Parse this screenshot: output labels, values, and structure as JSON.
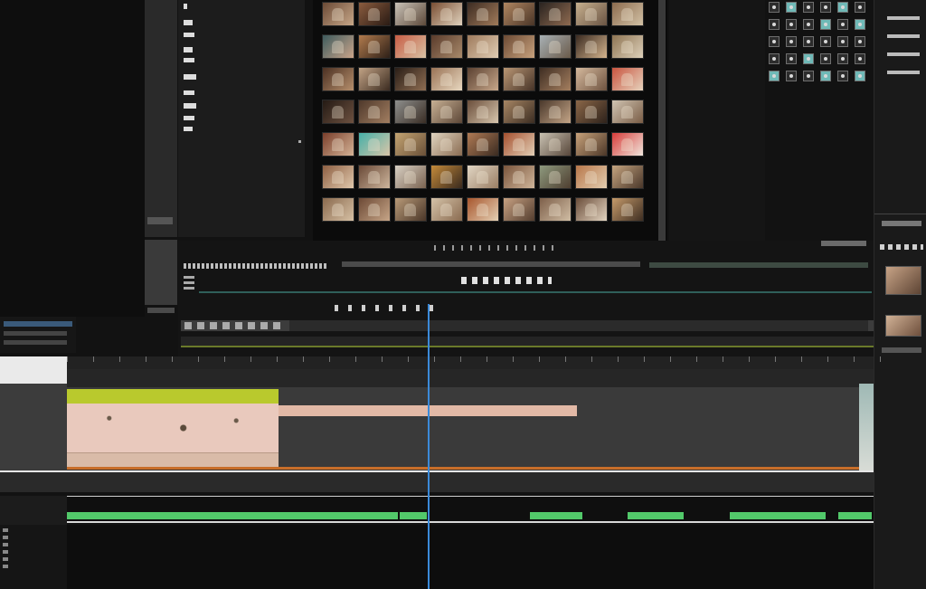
{
  "colors": {
    "background": "#121212",
    "panel": "#1b1b1b",
    "playhead": "#3b8ad9",
    "video_clip_bar": "#b9c92d",
    "video_clip_body": "#e8c5b8",
    "audio_clip": "#52c96a",
    "track_underline": "#c86e2a"
  },
  "icons": {
    "browser_view": "grid-icon",
    "effects": "effects-icon",
    "playhead": "playhead-icon"
  },
  "media_browser": {
    "thumbnails": [
      [
        "#6b4a36",
        "#c7a788"
      ],
      [
        "#8a5b3e",
        "#2a1b14"
      ],
      [
        "#c9c2b8",
        "#5d4a3a"
      ],
      [
        "#7a4e33",
        "#e0d2bd"
      ],
      [
        "#3d2c22",
        "#a07a5a"
      ],
      [
        "#b08661",
        "#4a3527"
      ],
      [
        "#2b2420",
        "#8e6a50"
      ],
      [
        "#c7b08e",
        "#6a5443"
      ],
      [
        "#8c6b4e",
        "#d2c1a5"
      ],
      [
        "#3e5b5d",
        "#caa48a"
      ],
      [
        "#b27b4d",
        "#2e2018"
      ],
      [
        "#c85d45",
        "#d8c2a4"
      ],
      [
        "#5a3b2b",
        "#a88a6b"
      ],
      [
        "#9e7a5c",
        "#e0cdb4"
      ],
      [
        "#6c4a34",
        "#c8a27d"
      ],
      [
        "#a8b1b5",
        "#6a5a4a"
      ],
      [
        "#3a2a20",
        "#d4b48e"
      ],
      [
        "#8e7452",
        "#ddd0ba"
      ],
      [
        "#4b3022",
        "#b68f6c"
      ],
      [
        "#c2a385",
        "#3b2b20"
      ],
      [
        "#2a1e17",
        "#8e6d52"
      ],
      [
        "#9a7356",
        "#e8d8c0"
      ],
      [
        "#5b4131",
        "#c7a78a"
      ],
      [
        "#b99674",
        "#463327"
      ],
      [
        "#3f2e23",
        "#a57f5f"
      ],
      [
        "#d5b99d",
        "#6e5340"
      ],
      [
        "#c9543f",
        "#e6d3bd"
      ],
      [
        "#241a14",
        "#6d5140"
      ],
      [
        "#4f392b",
        "#a27e61"
      ],
      [
        "#8e8f8d",
        "#3a2e25"
      ],
      [
        "#c7b094",
        "#5d4737"
      ],
      [
        "#6a4e3a",
        "#d8c6ae"
      ],
      [
        "#a78664",
        "#3c2d22"
      ],
      [
        "#4a382b",
        "#c4a587"
      ],
      [
        "#8b6748",
        "#2e221b"
      ],
      [
        "#d0c4b2",
        "#7a5d46"
      ],
      [
        "#7a3e2b",
        "#d4b396"
      ],
      [
        "#46b0a8",
        "#d9c5a8"
      ],
      [
        "#c4a472",
        "#6a5038"
      ],
      [
        "#e0d4c0",
        "#8a6c52"
      ],
      [
        "#b07a54",
        "#3a2b21"
      ],
      [
        "#a5502f",
        "#e2cfb6"
      ],
      [
        "#c9c2b2",
        "#57463a"
      ],
      [
        "#c8a27a",
        "#4c3728"
      ],
      [
        "#d73c3a",
        "#f0e6dc"
      ],
      [
        "#8d5f42",
        "#e0c8ac"
      ],
      [
        "#6a4a38",
        "#cdb59c"
      ],
      [
        "#d8d0c4",
        "#7a6350"
      ],
      [
        "#c48a3a",
        "#3a2a1e"
      ],
      [
        "#e1d6c4",
        "#9a7e64"
      ],
      [
        "#7a553c",
        "#cfb59a"
      ],
      [
        "#8e9a7e",
        "#4e3e30"
      ],
      [
        "#b8774a",
        "#e2cdb0"
      ],
      [
        "#c5a47f",
        "#4a372a"
      ],
      [
        "#8a6a4e",
        "#d6c0a4"
      ],
      [
        "#6d4a36",
        "#c6a587"
      ],
      [
        "#b89a78",
        "#4a3628"
      ],
      [
        "#d4c2a8",
        "#8a6b50"
      ],
      [
        "#a8562d",
        "#e4d0b4"
      ],
      [
        "#c7a182",
        "#533d2e"
      ],
      [
        "#7e604a",
        "#d0bda4"
      ],
      [
        "#6b4d3a",
        "#e2d4c0"
      ],
      [
        "#c59a6a",
        "#3e2e22"
      ]
    ]
  },
  "effects_browser": {
    "icons": [
      "plain",
      "teal",
      "plain",
      "plain",
      "teal",
      "plain",
      "plain",
      "plain",
      "plain",
      "teal",
      "plain",
      "teal",
      "plain",
      "plain",
      "plain",
      "plain",
      "plain",
      "plain",
      "plain",
      "plain",
      "teal",
      "plain",
      "plain",
      "plain",
      "teal",
      "plain",
      "plain",
      "teal",
      "plain",
      "teal"
    ]
  },
  "timeline": {
    "playhead_position": 0.462,
    "video_clips": [
      {
        "start": 0.0,
        "end": 0.262
      },
      {
        "start": 0.262,
        "end": 0.632
      }
    ],
    "audio_segments": [
      {
        "start": 0.0,
        "end": 0.413
      },
      {
        "start": 0.413,
        "end": 0.448
      },
      {
        "start": 0.574,
        "end": 0.641
      },
      {
        "start": 0.695,
        "end": 0.767
      },
      {
        "start": 0.822,
        "end": 0.943
      },
      {
        "start": 0.956,
        "end": 1.0
      }
    ]
  }
}
